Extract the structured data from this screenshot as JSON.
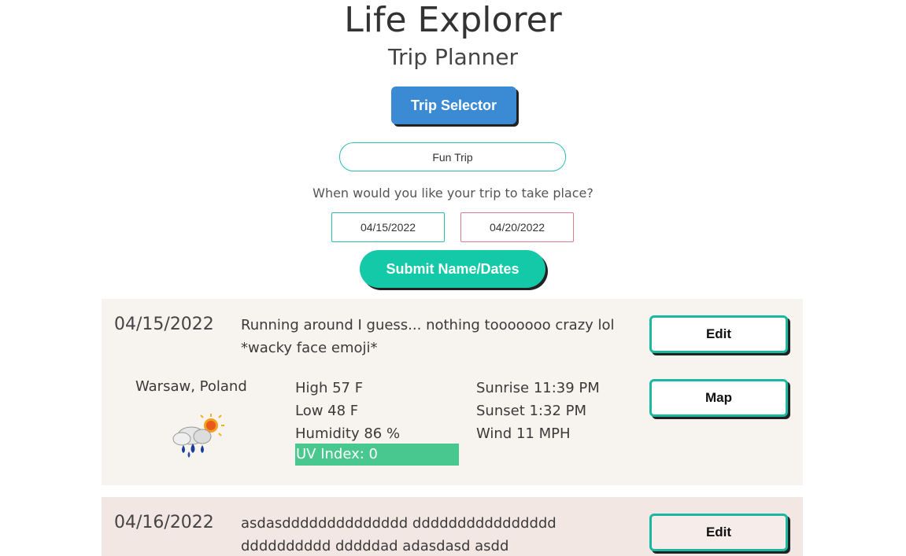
{
  "header": {
    "title": "Life Explorer",
    "subtitle": "Trip Planner"
  },
  "trip_selector_label": "Trip Selector",
  "trip_name": {
    "value": "Fun Trip"
  },
  "dates_prompt": "When would you like your trip to take place?",
  "start_date": "04/15/2022",
  "end_date": "04/20/2022",
  "submit_label": "Submit Name/Dates",
  "days": [
    {
      "date": "04/15/2022",
      "note": "Running around I guess... nothing tooooooo crazy lol *wacky face emoji*",
      "edit_label": "Edit",
      "map_label": "Map",
      "location": "Warsaw, Poland",
      "weather_icon": "rain-sun-icon",
      "high": "High 57 F",
      "low": "Low 48 F",
      "humidity": "Humidity 86 %",
      "uv_index": "UV Index: 0",
      "sunrise": "Sunrise 11:39 PM",
      "sunset": "Sunset 1:32 PM",
      "wind": "Wind 11 MPH"
    },
    {
      "date": "04/16/2022",
      "note": "asdasdddddddddddddd dddddddddddddddd dddddddddd dddddad adasdasd asdd",
      "edit_label": "Edit"
    }
  ],
  "colors": {
    "trip_selector_bg": "#3a8bd4",
    "submit_bg": "#14c9a8",
    "card_border": "#19b8a0",
    "uv_bg": "#48c78e",
    "card1_bg": "#f7f3ef",
    "card2_bg": "#f3e7e4"
  }
}
